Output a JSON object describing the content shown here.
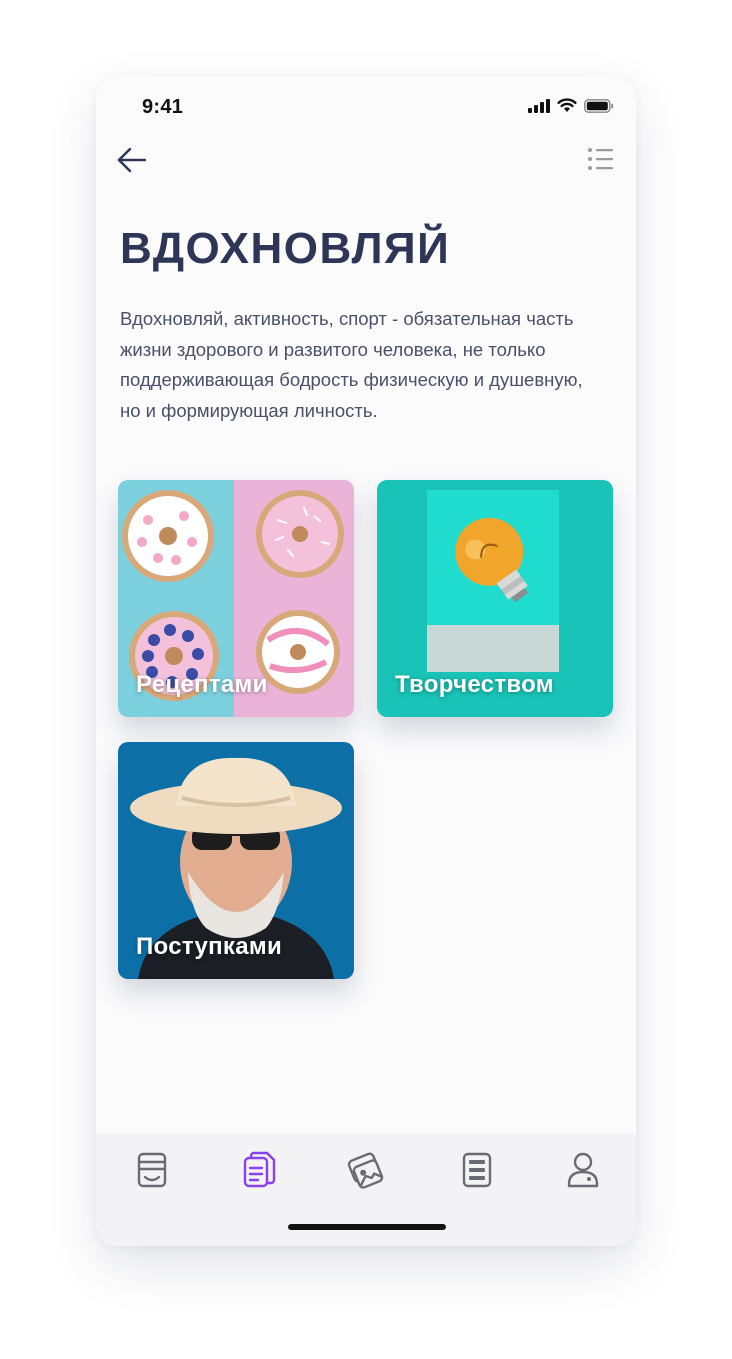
{
  "status": {
    "time": "9:41"
  },
  "header": {
    "back_icon": "arrow-left-icon",
    "menu_icon": "list-icon"
  },
  "page": {
    "title": "ВДОХНОВЛЯЙ",
    "description": "Вдохновляй, активность, спорт - обязательная часть жизни здорового и развитого человека, не только поддерживающая бодрость физическую и душевную, но и формирующая личность."
  },
  "cards": [
    {
      "label": "Рецептами",
      "image": "donuts-photo"
    },
    {
      "label": "Творчеством",
      "image": "lightbulb-photo"
    },
    {
      "label": "Поступками",
      "image": "man-in-hat-photo"
    }
  ],
  "tabbar": {
    "items": [
      {
        "icon": "feed-icon",
        "active": false
      },
      {
        "icon": "documents-icon",
        "active": true
      },
      {
        "icon": "cards-icon",
        "active": false
      },
      {
        "icon": "list-doc-icon",
        "active": false
      },
      {
        "icon": "profile-icon",
        "active": false
      }
    ],
    "active_color": "#8a3ff0",
    "inactive_color": "#6b6b72"
  },
  "colors": {
    "title": "#2d3656",
    "text": "#4a5068"
  }
}
